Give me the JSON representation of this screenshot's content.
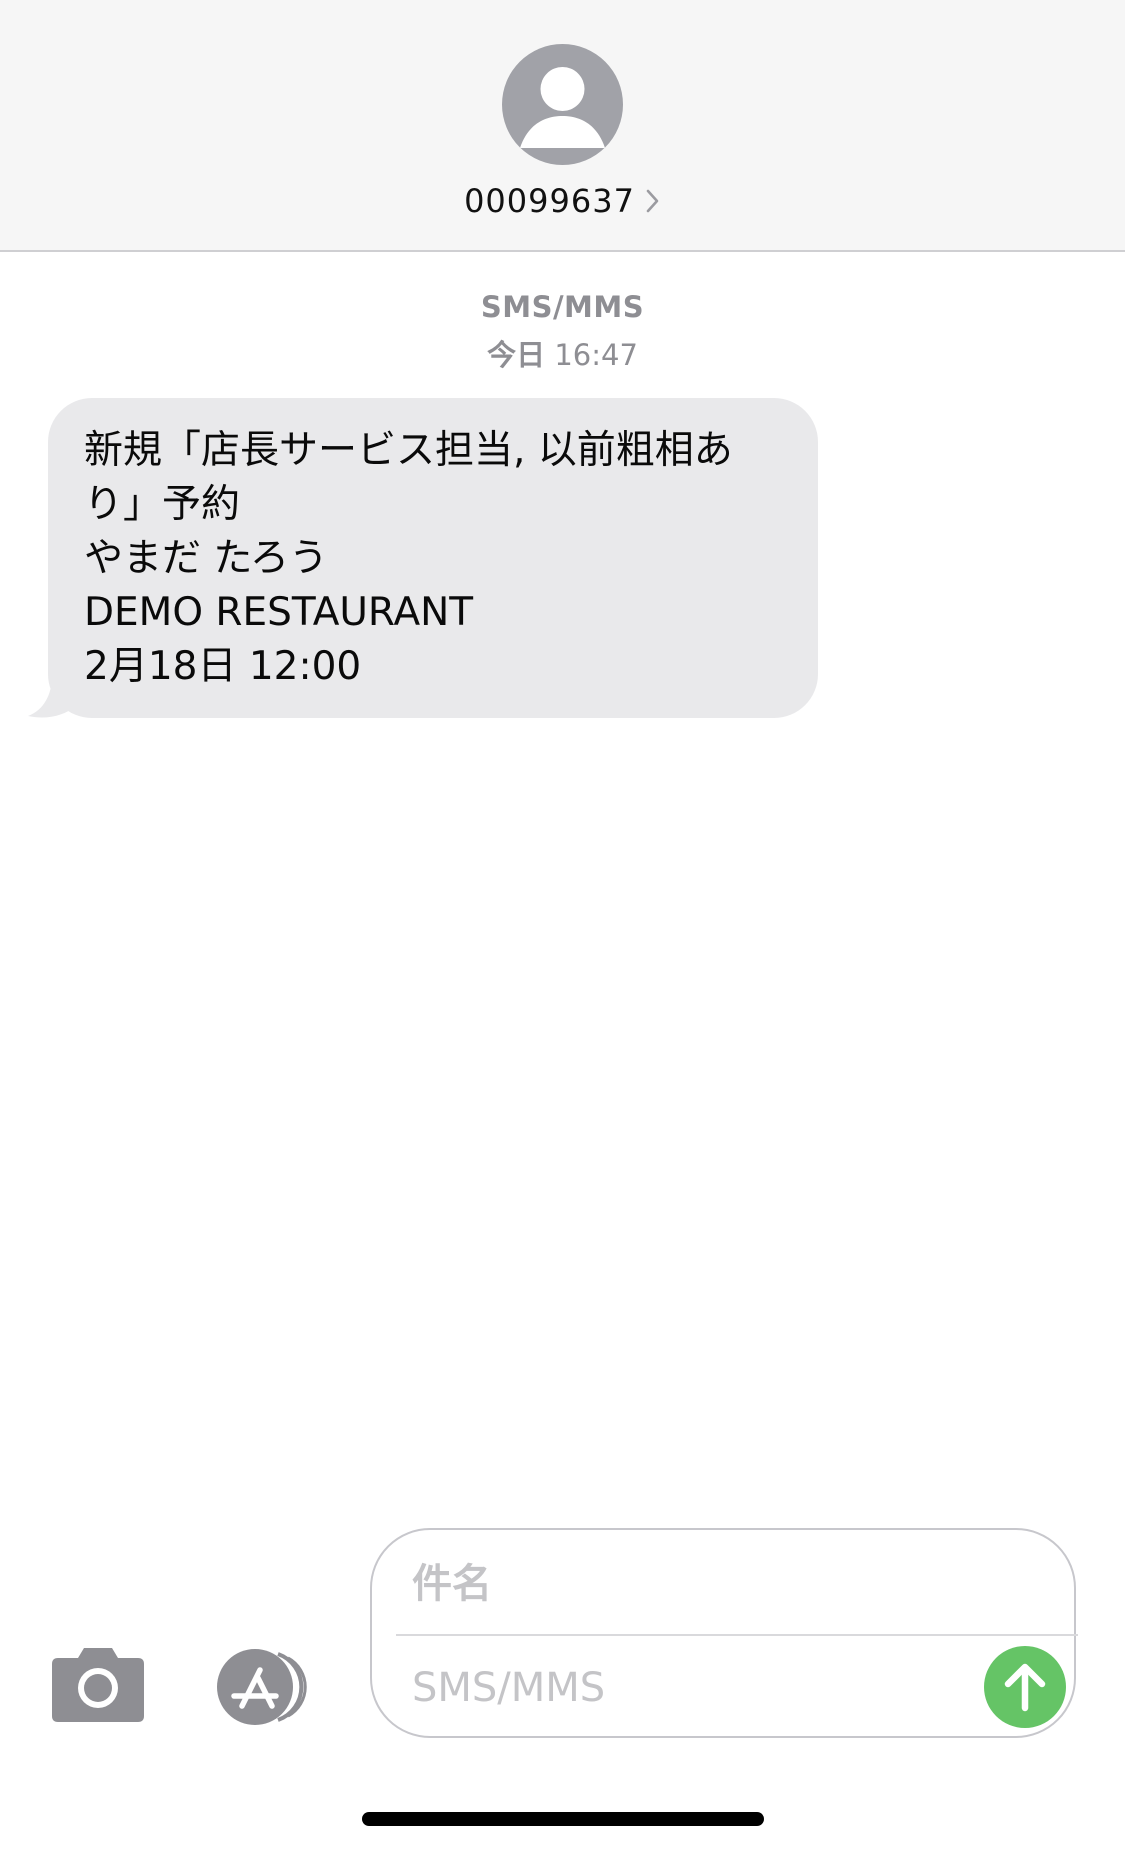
{
  "header": {
    "contact_name": "00099637",
    "avatar_icon": "person-silhouette-icon",
    "chevron_icon": "chevron-right-icon"
  },
  "thread": {
    "service_label": "SMS/MMS",
    "timestamp_day": "今日",
    "timestamp_time": "16:47",
    "messages": [
      {
        "direction": "incoming",
        "lines": [
          "新規「店長サービス担当, 以前粗相あ",
          "り」予約",
          "やまだ たろう",
          "DEMO RESTAURANT",
          "2月18日 12:00"
        ]
      }
    ]
  },
  "composer": {
    "camera_icon": "camera-icon",
    "appstore_icon": "app-store-icon",
    "subject_placeholder": "件名",
    "message_placeholder": "SMS/MMS",
    "send_icon": "arrow-up-icon"
  },
  "colors": {
    "header_bg": "#f6f6f6",
    "incoming_bubble": "#e9e9eb",
    "send_button": "#65c466",
    "secondary_text": "#8e8e93"
  }
}
